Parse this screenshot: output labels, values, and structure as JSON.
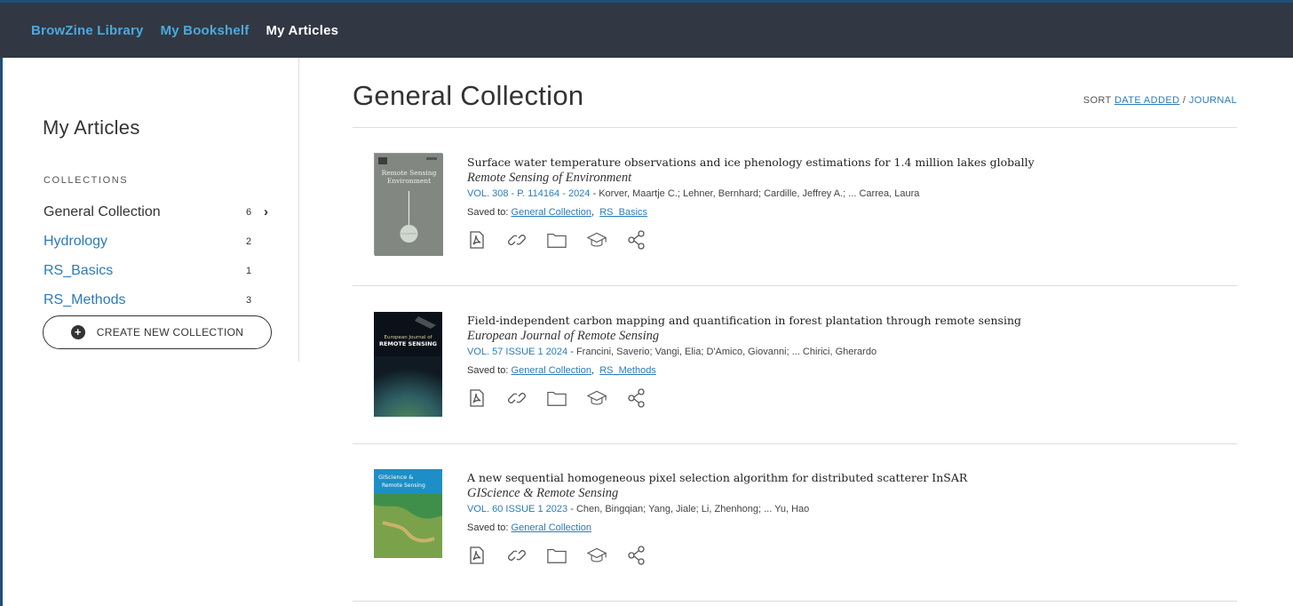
{
  "topnav": {
    "items": [
      {
        "label": "BrowZine Library"
      },
      {
        "label": "My Bookshelf"
      },
      {
        "label": "My Articles"
      }
    ]
  },
  "sidebar": {
    "title": "My Articles",
    "collections_heading": "COLLECTIONS",
    "collections": [
      {
        "name": "General Collection",
        "count": "6"
      },
      {
        "name": "Hydrology",
        "count": "2"
      },
      {
        "name": "RS_Basics",
        "count": "1"
      },
      {
        "name": "RS_Methods",
        "count": "3"
      }
    ],
    "create_button": "CREATE NEW COLLECTION"
  },
  "main": {
    "title": "General Collection",
    "sort": {
      "label": "SORT",
      "option_date": "DATE ADDED",
      "separator": "/",
      "option_journal": "JOURNAL"
    },
    "articles": [
      {
        "title": "Surface water temperature observations and ice phenology estimations for 1.4 million lakes globally",
        "journal": "Remote Sensing of Environment",
        "volume": "VOL. 308 - P. 114164 - 2024",
        "authors": "Korver, Maartje C.; Lehner, Bernhard; Cardille, Jeffrey A.; ... Carrea, Laura",
        "saved_label": "Saved to:",
        "saved_to": [
          "General Collection",
          "RS_Basics"
        ],
        "cover_text": [
          "Remote Sensing",
          "Environment"
        ]
      },
      {
        "title": "Field-independent carbon mapping and quantification in forest plantation through remote sensing",
        "journal": "European Journal of Remote Sensing",
        "volume": "VOL. 57 ISSUE 1 2024",
        "authors": "Francini, Saverio; Vangi, Elia; D'Amico, Giovanni; ... Chirici, Gherardo",
        "saved_label": "Saved to:",
        "saved_to": [
          "General Collection",
          "RS_Methods"
        ],
        "cover_text": [
          "European Journal of",
          "REMOTE SENSING"
        ]
      },
      {
        "title": "A new sequential homogeneous pixel selection algorithm for distributed scatterer InSAR",
        "journal": "GIScience & Remote Sensing",
        "volume": "VOL. 60 ISSUE 1 2023",
        "authors": "Chen, Bingqian; Yang, Jiale; Li, Zhenhong; ... Yu, Hao",
        "saved_label": "Saved to:",
        "saved_to": [
          "General Collection"
        ],
        "cover_text": [
          "GIScience &",
          "Remote Sensing"
        ]
      }
    ],
    "action_icons": [
      "pdf-icon",
      "link-icon",
      "folder-icon",
      "graduation-cap-icon",
      "share-icon"
    ]
  },
  "colors": {
    "nav_bg": "#313843",
    "link": "#2b7bb9",
    "nav_link": "#4ea8dc"
  }
}
